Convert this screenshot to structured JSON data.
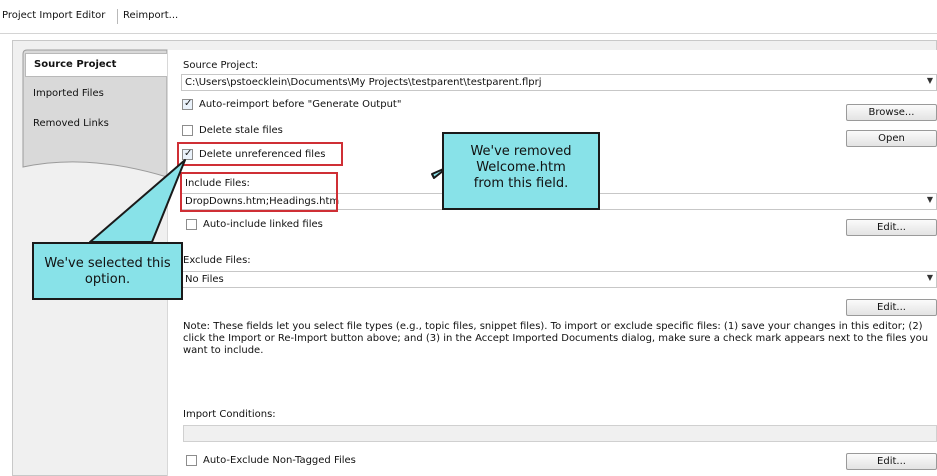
{
  "tabs": [
    {
      "label": "Project Import Editor"
    },
    {
      "label": "Reimport..."
    }
  ],
  "sidebar": {
    "items": [
      {
        "label": "Source Project"
      },
      {
        "label": "Imported Files"
      },
      {
        "label": "Removed Links"
      }
    ]
  },
  "source_project": {
    "label": "Source Project:",
    "value": "C:\\Users\\pstoecklein\\Documents\\My Projects\\testparent\\testparent.flprj",
    "browse_label": "Browse...",
    "open_label": "Open"
  },
  "options": {
    "auto_reimport": {
      "label": "Auto-reimport before \"Generate Output\"",
      "checked": true
    },
    "delete_stale": {
      "label": "Delete stale files",
      "checked": false
    },
    "delete_unreferenced": {
      "label": "Delete unreferenced files",
      "checked": true
    }
  },
  "include_files": {
    "label": "Include Files:",
    "value": "DropDowns.htm;Headings.htm",
    "auto_include_label": "Auto-include linked files",
    "edit_label": "Edit..."
  },
  "exclude_files": {
    "label": "Exclude Files:",
    "value": "No Files",
    "edit_label": "Edit..."
  },
  "note": {
    "text": "Note: These fields let you select file types (e.g., topic files, snippet files). To import or exclude specific files: (1) save your changes in this editor; (2) click the Import or Re-Import button above; and (3) in the Accept Imported Documents dialog, make sure a check mark appears next to the files you want to include."
  },
  "import_conditions": {
    "label": "Import Conditions:",
    "value": "",
    "auto_exclude_label": "Auto-Exclude Non-Tagged Files",
    "edit_label": "Edit..."
  },
  "callouts": {
    "removed": "We've removed Welcome.htm from this field.",
    "selected": "We've selected this option."
  },
  "colors": {
    "callout_fill": "#88e2e8",
    "highlight": "#cf2f35"
  }
}
